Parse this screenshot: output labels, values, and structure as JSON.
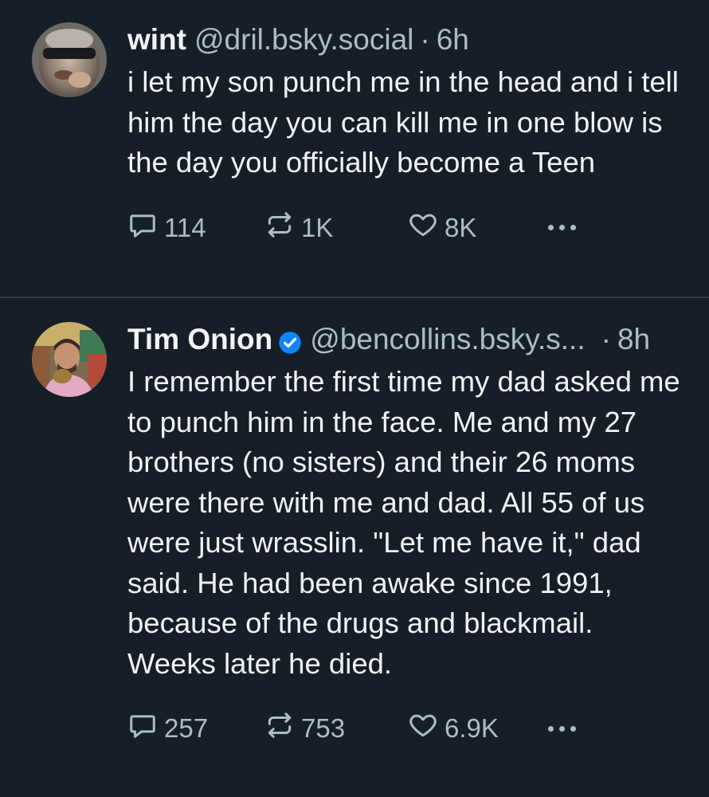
{
  "posts": [
    {
      "display_name": "wint",
      "handle": "@dril.bsky.social",
      "separator": "·",
      "time": "6h",
      "verified": false,
      "text": "i let my son punch me in the head and i tell him the day you can kill me in one blow is the day you officially become a Teen",
      "replies": "114",
      "reposts": "1K",
      "likes": "8K"
    },
    {
      "display_name": "Tim Onion",
      "handle": "@bencollins.bsky.s...",
      "separator": "·",
      "time": "8h",
      "verified": true,
      "text": "I remember the first time my dad asked me to punch him in the face. Me and my 27 brothers (no sisters) and their 26 moms were there with me and dad. All 55 of us were just wrasslin. \"Let me have it,\" dad said. He had been awake since 1991, because of the drugs and blackmail. Weeks later he died.",
      "replies": "257",
      "reposts": "753",
      "likes": "6.9K"
    }
  ],
  "icons": {
    "reply": "speech-bubble-icon",
    "repost": "repost-arrows-icon",
    "like": "heart-icon",
    "more": "ellipsis-icon",
    "verified": "verified-check-icon"
  },
  "colors": {
    "background": "#161e27",
    "text": "#f1f3f5",
    "muted": "#aebbc9",
    "verified": "#1083fe",
    "divider": "#2e3a48"
  }
}
